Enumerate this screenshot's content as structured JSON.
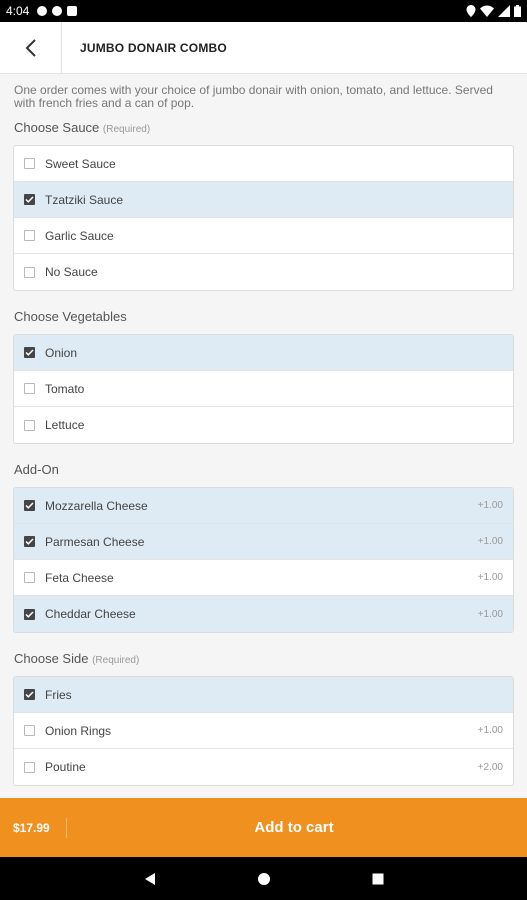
{
  "status_bar": {
    "time": "4:04",
    "icons": [
      "app-notification-icon",
      "app-notification-icon",
      "sim-icon",
      "location-icon",
      "wifi-icon",
      "signal-icon",
      "battery-icon"
    ]
  },
  "app_bar": {
    "title": "JUMBO DONAIR COMBO",
    "back_icon": "back-arrow-icon"
  },
  "description": "One order comes with your choice of jumbo donair with onion, tomato, and lettuce. Served with french fries and a can of pop.",
  "sections": [
    {
      "title": "Choose Sauce",
      "required": "(Required)",
      "options": [
        {
          "label": "Sweet Sauce",
          "checked": false,
          "price": ""
        },
        {
          "label": "Tzatziki Sauce",
          "checked": true,
          "price": ""
        },
        {
          "label": "Garlic Sauce",
          "checked": false,
          "price": ""
        },
        {
          "label": "No Sauce",
          "checked": false,
          "price": ""
        }
      ]
    },
    {
      "title": "Choose Vegetables",
      "required": "",
      "options": [
        {
          "label": "Onion",
          "checked": true,
          "price": ""
        },
        {
          "label": "Tomato",
          "checked": false,
          "price": ""
        },
        {
          "label": "Lettuce",
          "checked": false,
          "price": ""
        }
      ]
    },
    {
      "title": "Add-On",
      "required": "",
      "options": [
        {
          "label": "Mozzarella Cheese",
          "checked": true,
          "price": "+1.00"
        },
        {
          "label": "Parmesan Cheese",
          "checked": true,
          "price": "+1.00"
        },
        {
          "label": "Feta Cheese",
          "checked": false,
          "price": "+1.00"
        },
        {
          "label": "Cheddar Cheese",
          "checked": true,
          "price": "+1.00"
        }
      ]
    },
    {
      "title": "Choose Side",
      "required": "(Required)",
      "options": [
        {
          "label": "Fries",
          "checked": true,
          "price": ""
        },
        {
          "label": "Onion Rings",
          "checked": false,
          "price": "+1.00"
        },
        {
          "label": "Poutine",
          "checked": false,
          "price": "+2.00"
        }
      ]
    }
  ],
  "footer": {
    "total": "$17.99",
    "button_label": "Add to cart"
  },
  "colors": {
    "accent": "#f0901f",
    "selected_row": "#deebf5",
    "checkbox_on": "#454545"
  },
  "nav_bar": {
    "icons": [
      "back-triangle-icon",
      "home-circle-icon",
      "recents-square-icon"
    ]
  }
}
